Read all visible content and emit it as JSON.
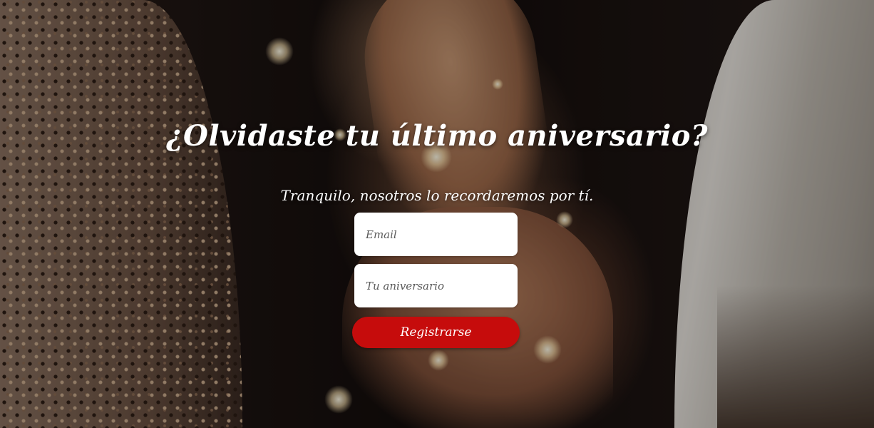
{
  "hero": {
    "title": "¿Olvidaste tu último aniversario?",
    "subtitle": "Tranquilo, nosotros lo recordaremos por tí."
  },
  "form": {
    "email_placeholder": "Email",
    "anniversary_placeholder": "Tu aniversario",
    "submit_label": "Registrarse"
  },
  "colors": {
    "button": "#c60c0c",
    "text": "#ffffff",
    "field_background": "#ffffff"
  }
}
